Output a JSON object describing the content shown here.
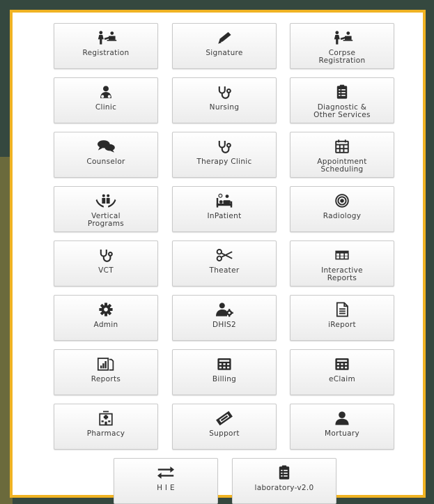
{
  "tiles": [
    {
      "label": "Registration",
      "icon": "registration-icon"
    },
    {
      "label": "Signature",
      "icon": "pencil-icon"
    },
    {
      "label": "Corpse\nRegistration",
      "icon": "corpse-registration-icon"
    },
    {
      "label": "Clinic",
      "icon": "doctor-icon"
    },
    {
      "label": "Nursing",
      "icon": "stethoscope-icon"
    },
    {
      "label": "Diagnostic &\nOther Services",
      "icon": "clipboard-list-icon"
    },
    {
      "label": "Counselor",
      "icon": "chat-bubbles-icon"
    },
    {
      "label": "Therapy Clinic",
      "icon": "stethoscope-icon"
    },
    {
      "label": "Appointment\nScheduling",
      "icon": "calendar-icon"
    },
    {
      "label": "Vertical\nPrograms",
      "icon": "family-hands-icon"
    },
    {
      "label": "InPatient",
      "icon": "hospital-bed-icon"
    },
    {
      "label": "Radiology",
      "icon": "target-icon"
    },
    {
      "label": "VCT",
      "icon": "stethoscope-icon"
    },
    {
      "label": "Theater",
      "icon": "scissors-icon"
    },
    {
      "label": "Interactive\nReports",
      "icon": "table-icon"
    },
    {
      "label": "Admin",
      "icon": "gear-icon"
    },
    {
      "label": "DHIS2",
      "icon": "user-gear-icon"
    },
    {
      "label": "iReport",
      "icon": "document-icon"
    },
    {
      "label": "Reports",
      "icon": "report-chart-icon"
    },
    {
      "label": "Billing",
      "icon": "calculator-icon"
    },
    {
      "label": "eClaim",
      "icon": "calculator-icon"
    },
    {
      "label": "Pharmacy",
      "icon": "hospital-building-icon"
    },
    {
      "label": "Support",
      "icon": "ticket-icon"
    },
    {
      "label": "Mortuary",
      "icon": "user-silhouette-icon"
    },
    {
      "label": "H I E",
      "icon": "exchange-arrows-icon"
    },
    {
      "label": "laboratory-v2.0",
      "icon": "clipboard-list-icon"
    }
  ],
  "colors": {
    "frame_border": "#f0b323",
    "icon": "#2b2b2b",
    "background": "#35483f"
  }
}
